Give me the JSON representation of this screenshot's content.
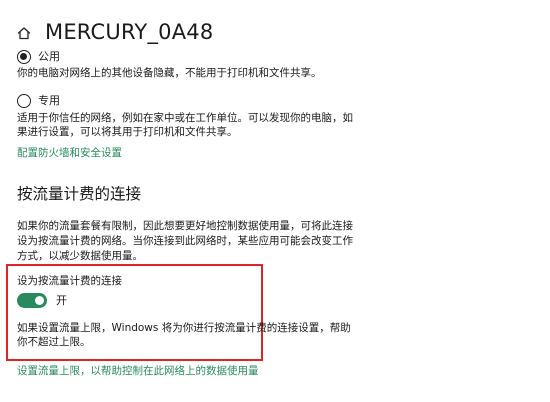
{
  "header": {
    "title": "MERCURY_0A48",
    "home_icon": "home-icon"
  },
  "network_profile": {
    "public": {
      "label": "公用",
      "checked": true,
      "description": "你的电脑对网络上的其他设备隐藏，不能用于打印机和文件共享。"
    },
    "private": {
      "label": "专用",
      "checked": false,
      "description_line1": "适用于你信任的网络，例如在家中或在工作单位。可以发现你的电脑，如",
      "description_line2": "果进行设置，可以将其用于打印机和文件共享。"
    },
    "firewall_link": "配置防火墙和安全设置"
  },
  "metered": {
    "section_title": "按流量计费的连接",
    "description_line1": "如果你的流量套餐有限制，因此想要更好地控制数据使用量，可将此连接",
    "description_line2": "设为按流量计费的网络。当你连接到此网络时，某些应用可能会改变工作",
    "description_line3": "方式，以减少数据使用量。",
    "toggle_label": "设为按流量计费的连接",
    "toggle_state": "开",
    "toggle_on": true,
    "toggle_desc_line1": "如果设置流量上限，Windows 将为你进行按流量计费的连接设置，帮助",
    "toggle_desc_line2": "你不超过上限。",
    "data_limit_link": "设置流量上限，以帮助控制在此网络上的数据使用量"
  },
  "colors": {
    "accent": "#2a8a5f",
    "highlight_border": "#d9262a"
  }
}
